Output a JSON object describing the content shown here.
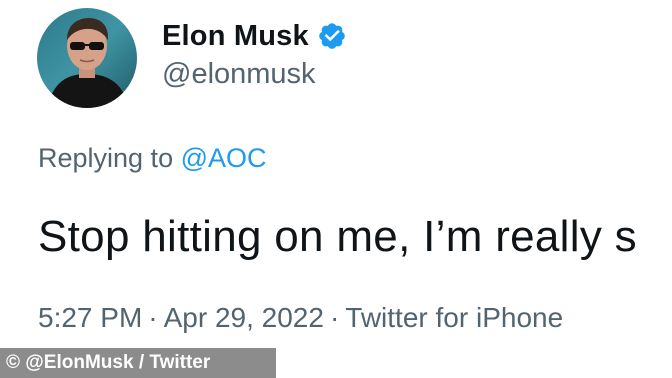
{
  "tweet": {
    "author": {
      "display_name": "Elon Musk",
      "handle": "@elonmusk",
      "verified": true,
      "verified_icon": "verified-badge-icon"
    },
    "replying_to": {
      "prefix": "Replying to ",
      "mention": "@AOC"
    },
    "text": "Stop hitting on me, I’m really s",
    "meta": {
      "time": "5:27 PM",
      "separator": "·",
      "date": "Apr 29, 2022",
      "source": "Twitter for iPhone"
    }
  },
  "credit": "© @ElonMusk / Twitter",
  "colors": {
    "accent": "#1d9bf0",
    "secondary_text": "#536471",
    "primary_text": "#0f1419",
    "credit_bg": "#8c8c8c"
  }
}
